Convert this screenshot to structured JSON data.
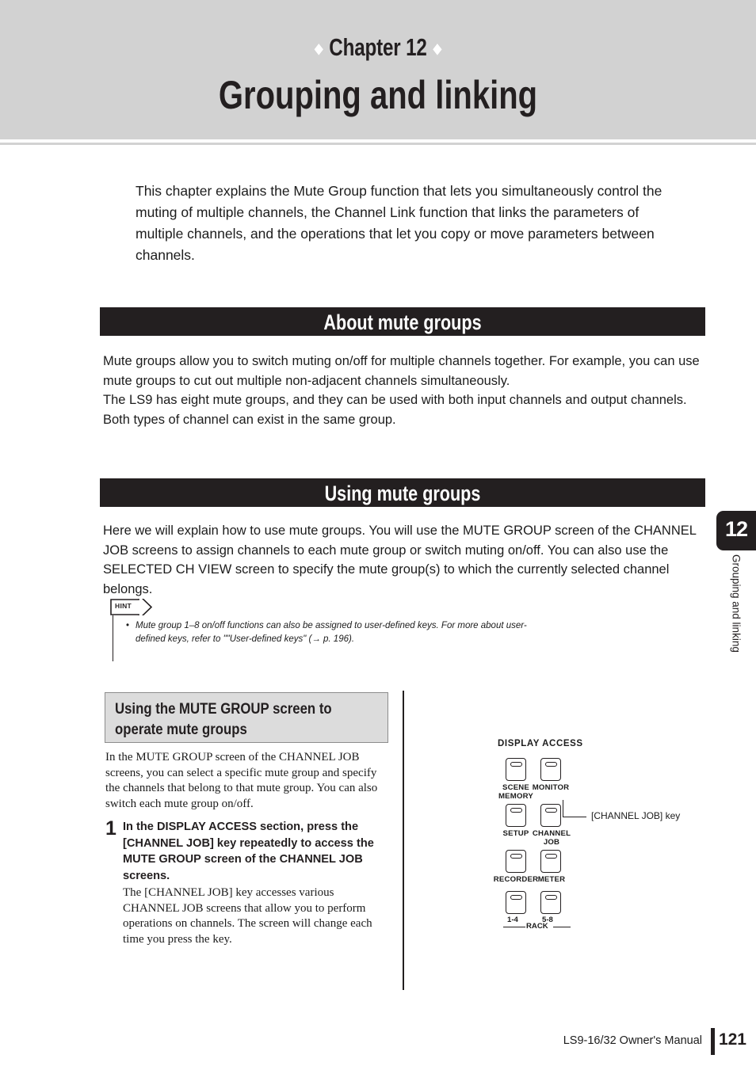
{
  "banner": {
    "chapter_prefix": "Chapter 12",
    "diamond_icon": "◆",
    "title": "Grouping and linking"
  },
  "intro": "This chapter explains the Mute Group function that lets you simultaneously control the muting of multiple channels, the Channel Link function that links the parameters of multiple channels, and the operations that let you copy or move parameters between channels.",
  "sections": {
    "about": {
      "heading": "About mute groups",
      "body": "Mute groups allow you to switch muting on/off for multiple channels together. For example, you can use mute groups to cut out multiple non-adjacent channels simultaneously.\nThe LS9 has eight mute groups, and they can be used with both input channels and output channels. Both types of channel can exist in the same group."
    },
    "using": {
      "heading": "Using mute groups",
      "body": "Here we will explain how to use mute groups. You will use the MUTE GROUP screen of the CHANNEL JOB screens to assign channels to each mute group or switch muting on/off. You can also use the SELECTED CH VIEW screen to specify the mute group(s) to which the currently selected channel belongs."
    }
  },
  "hint": {
    "badge_label": "HINT",
    "bullet": "•",
    "note": "Mute group 1–8 on/off functions can also be assigned to user-defined keys. For more about user-defined keys, refer to \"\"User-defined keys\" (→ p. 196)."
  },
  "subsection": {
    "heading": "Using the MUTE GROUP screen to operate mute groups",
    "intro": "In the MUTE GROUP screen of the CHANNEL JOB screens, you can select a specific mute group and specify the channels that belong to that mute group. You can also switch each mute group on/off.",
    "step": {
      "number": "1",
      "instruction": "In the DISPLAY ACCESS section, press the [CHANNEL JOB] key repeatedly to access the MUTE GROUP screen of the CHANNEL JOB screens.",
      "detail": "The [CHANNEL JOB] key accesses various CHANNEL JOB screens that allow you to perform operations on channels. The screen will change each time you press the key."
    }
  },
  "diagram": {
    "section_title": "DISPLAY ACCESS",
    "callout": "[CHANNEL JOB] key",
    "rack_label": "RACK",
    "keys": [
      {
        "label": "SCENE\nMEMORY",
        "line1": "SCENE",
        "line2": "MEMORY"
      },
      {
        "label": "MONITOR",
        "line1": "MONITOR",
        "line2": ""
      },
      {
        "label": "SETUP",
        "line1": "SETUP",
        "line2": ""
      },
      {
        "label": "CHANNEL JOB",
        "line1": "CHANNEL",
        "line2": "JOB"
      },
      {
        "label": "RECORDER",
        "line1": "RECORDER",
        "line2": ""
      },
      {
        "label": "METER",
        "line1": "METER",
        "line2": ""
      },
      {
        "label": "1-4",
        "line1": "1-4",
        "line2": ""
      },
      {
        "label": "5-8",
        "line1": "5-8",
        "line2": ""
      }
    ]
  },
  "sidetab": {
    "number": "12",
    "label": "Grouping and linking"
  },
  "footer": {
    "manual": "LS9-16/32  Owner's Manual",
    "page": "121"
  },
  "colors": {
    "banner_bg": "#d2d2d2",
    "bar_bg": "#231f20",
    "subhead_bg": "#dcdcdc"
  }
}
